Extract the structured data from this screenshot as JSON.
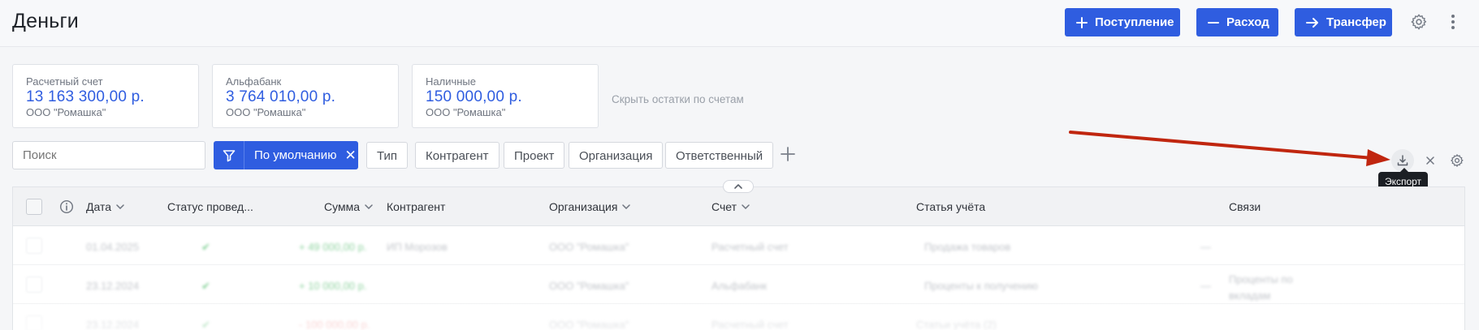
{
  "header": {
    "title": "Деньги",
    "buttons": {
      "income": "Поступление",
      "expense": "Расход",
      "transfer": "Трансфер"
    }
  },
  "accounts": [
    {
      "name": "Расчетный счет",
      "balance": "13 163 300,00 р.",
      "org": "ООО \"Ромашка\""
    },
    {
      "name": "Альфабанк",
      "balance": "3 764 010,00 р.",
      "org": "ООО \"Ромашка\""
    },
    {
      "name": "Наличные",
      "balance": "150 000,00 р.",
      "org": "ООО \"Ромашка\""
    }
  ],
  "hide_balances_label": "Скрыть остатки по счетам",
  "filters": {
    "search_placeholder": "Поиск",
    "active_filter": "По умолчанию",
    "chips": [
      "Тип",
      "Контрагент",
      "Проект",
      "Организация",
      "Ответственный"
    ]
  },
  "tools": {
    "export_tooltip": "Экспорт"
  },
  "table": {
    "columns": {
      "date": "Дата",
      "status": "Статус провед...",
      "amount": "Сумма",
      "counterparty": "Контрагент",
      "organization": "Организация",
      "account": "Счет",
      "category": "Статья учёта",
      "links": "Связи"
    },
    "rows": [
      {
        "date": "01.04.2025",
        "status": "✔",
        "amount": "+ 49 000,00 р.",
        "amount_sign": "pos",
        "counterparty": "ИП Морозов",
        "organization": "ООО \"Ромашка\"",
        "account": "Расчетный счет",
        "category": "Продажа товаров",
        "marker": "—",
        "links": ""
      },
      {
        "date": "23.12.2024",
        "status": "✔",
        "amount": "+ 10 000,00 р.",
        "amount_sign": "pos",
        "counterparty": "",
        "organization": "ООО \"Ромашка\"",
        "account": "Альфабанк",
        "category": "Проценты к получению",
        "marker": "—",
        "links": "Проценты по вкладам"
      },
      {
        "date": "23.12.2024",
        "status": "✔",
        "amount": "- 100 000,00 р.",
        "amount_sign": "neg",
        "counterparty": "",
        "organization": "ООО \"Ромашка\"",
        "account": "Расчетный счет",
        "category": "Статьи учёта (2)",
        "marker": "",
        "links": ""
      }
    ]
  },
  "colors": {
    "accent": "#2f5de0",
    "annotation_arrow": "#c0260f"
  }
}
